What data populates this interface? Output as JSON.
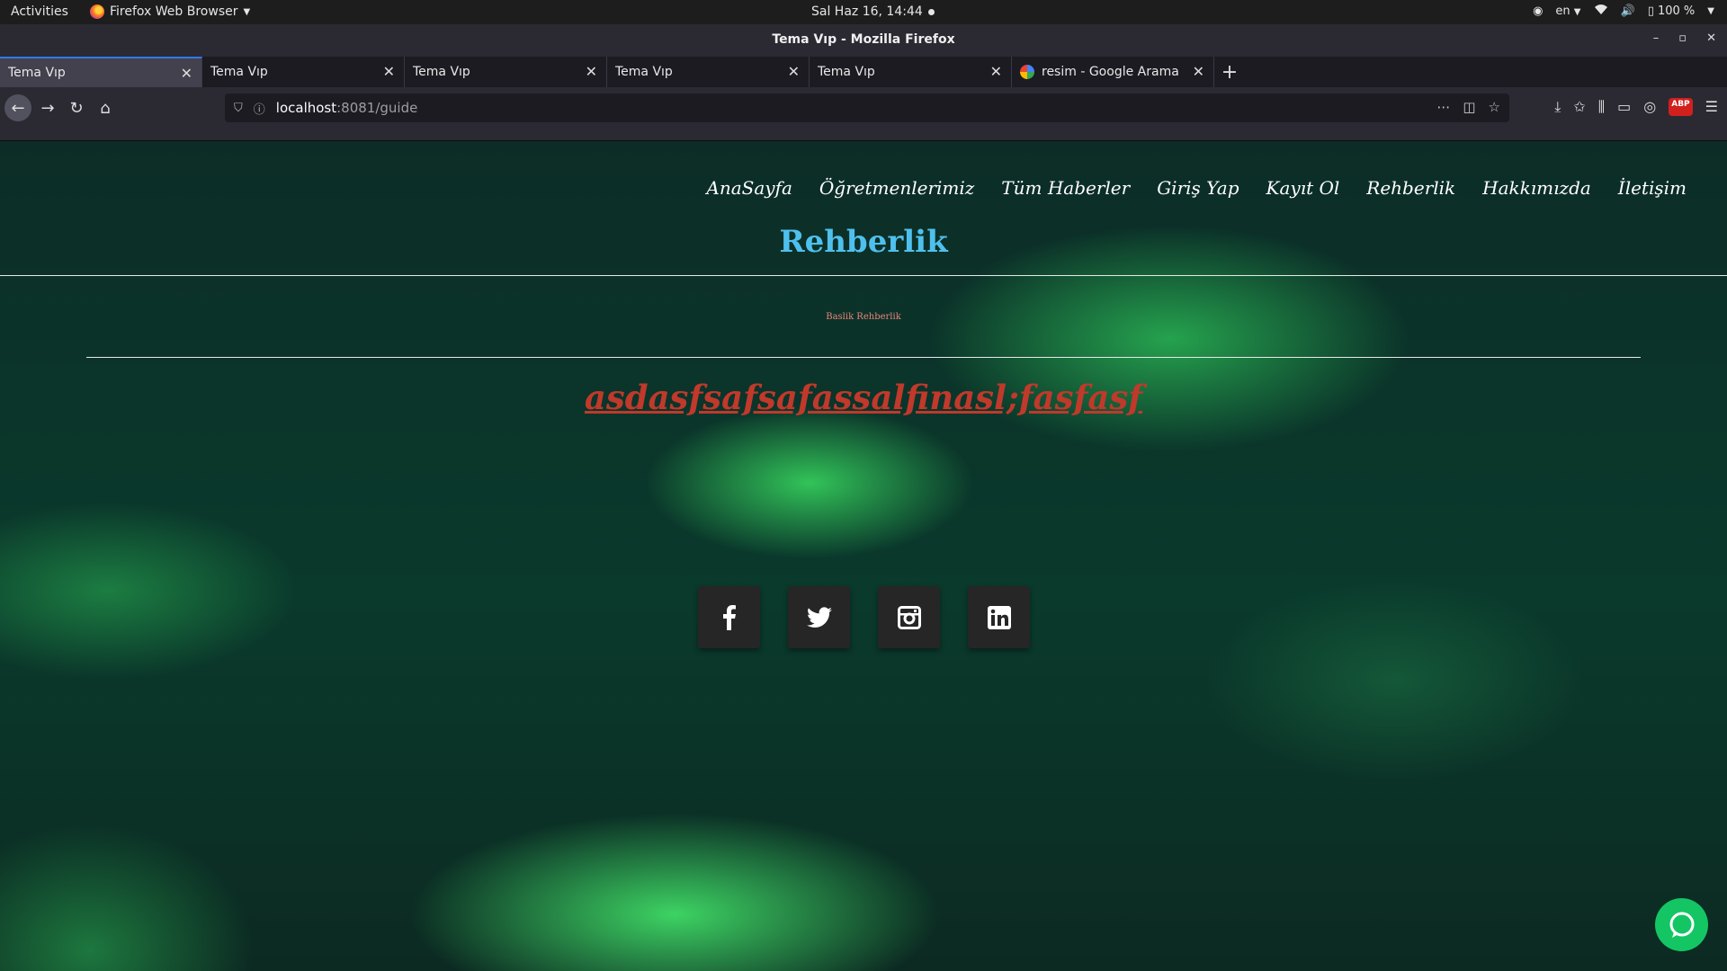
{
  "topbar": {
    "activities": "Activities",
    "app_name": "Firefox Web Browser",
    "clock": "Sal Haz 16, 14:44",
    "lang": "en",
    "battery": "100 %"
  },
  "window": {
    "title": "Tema Vıp - Mozilla Firefox"
  },
  "tabs": [
    {
      "label": "Tema Vıp",
      "active": true
    },
    {
      "label": "Tema Vıp",
      "active": false
    },
    {
      "label": "Tema Vıp",
      "active": false
    },
    {
      "label": "Tema Vıp",
      "active": false
    },
    {
      "label": "Tema Vıp",
      "active": false
    },
    {
      "label": "resim - Google Arama",
      "active": false
    }
  ],
  "url": {
    "host": "localhost",
    "path": ":8081/guide"
  },
  "page": {
    "menu": [
      "AnaSayfa",
      "Öğretmenlerimiz",
      "Tüm Haberler",
      "Giriş Yap",
      "Kayıt Ol",
      "Rehberlik",
      "Hakkımızda",
      "İletişim"
    ],
    "title": "Rehberlik",
    "small_title": "Baslik Rehberlik",
    "link_text": "asdasfsafsafassalfinasl;fasfasf",
    "socials": [
      "facebook-icon",
      "twitter-icon",
      "instagram-icon",
      "linkedin-icon"
    ],
    "colors": {
      "title": "#4fc0ee",
      "link": "#c0392b",
      "small_title": "#e8847a",
      "chat": "#14c564"
    }
  }
}
